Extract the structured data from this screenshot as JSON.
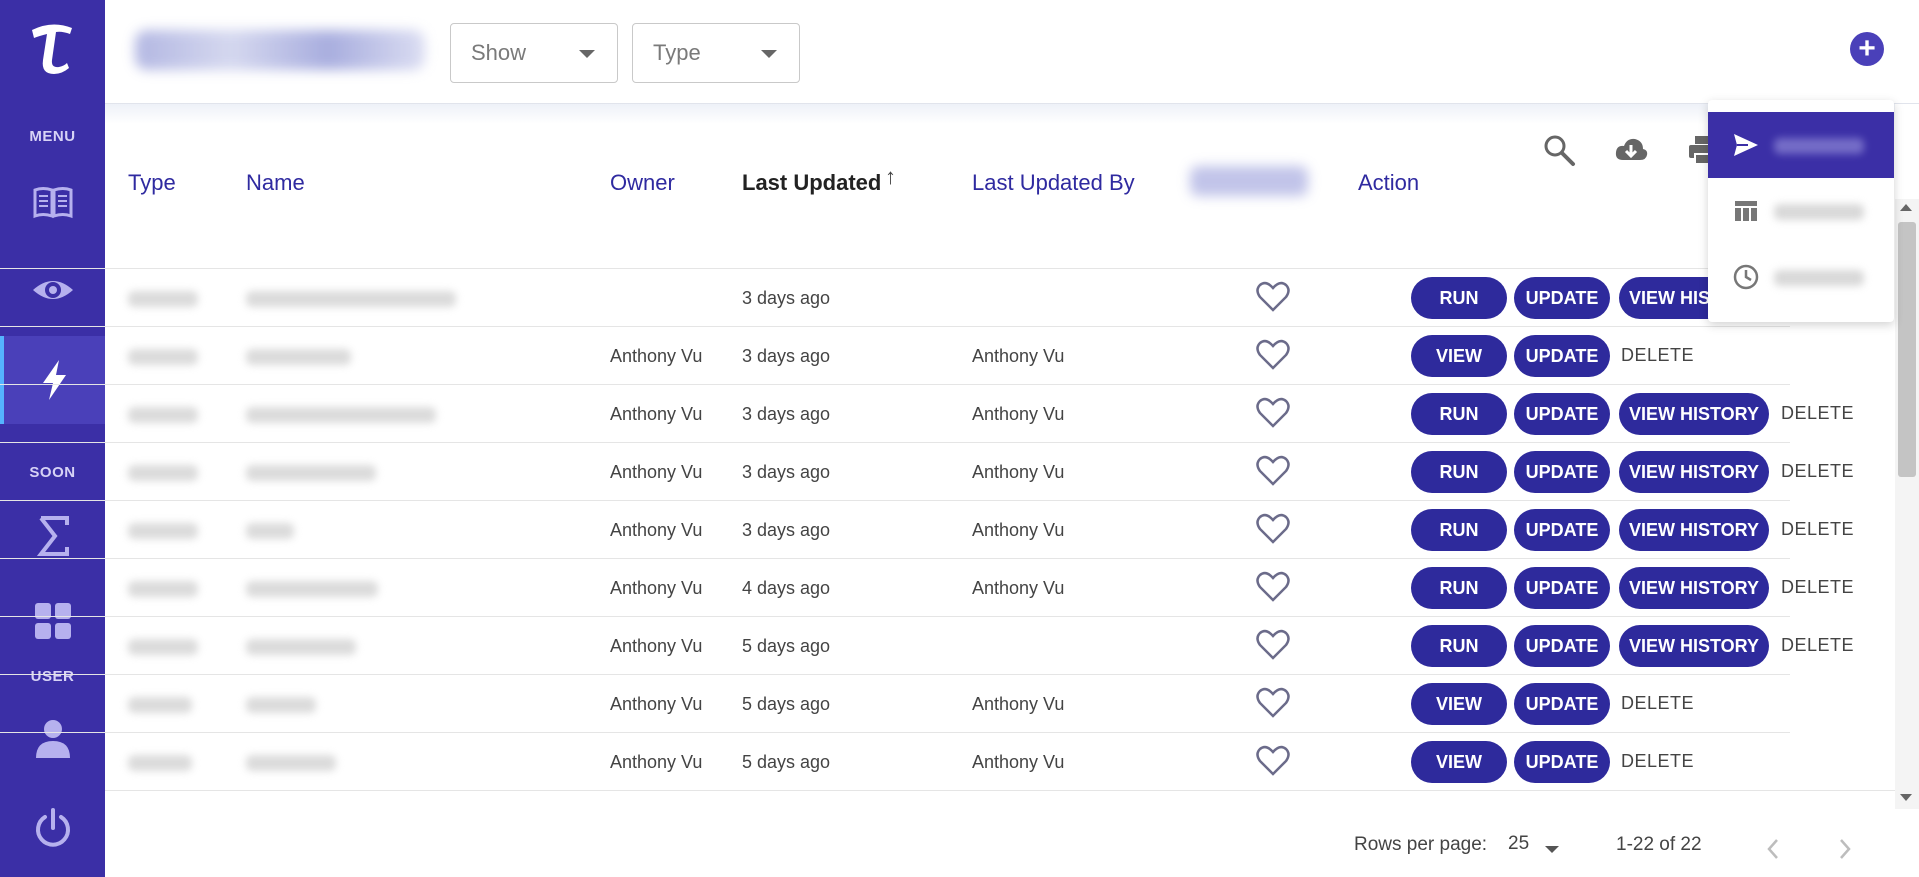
{
  "colors": {
    "sidebar": "#3b2fa6",
    "accent": "#2e2a9c",
    "header_link": "#2f2aa0",
    "active_indicator": "#55b3ff"
  },
  "sidebar": {
    "menu_label": "MENU",
    "soon_label": "SOON",
    "user_label": "USER",
    "items": [
      {
        "icon": "book-icon"
      },
      {
        "icon": "eye-icon"
      },
      {
        "icon": "lightning-icon",
        "active": true
      },
      {
        "icon": "sigma-icon"
      },
      {
        "icon": "dashboard-icon"
      },
      {
        "icon": "user-icon"
      },
      {
        "icon": "power-icon"
      }
    ]
  },
  "topbar": {
    "show_select": {
      "label": "Show"
    },
    "type_select": {
      "label": "Type"
    },
    "add_icon": "plus-circle-icon"
  },
  "toolbar": {
    "icons": [
      "search-icon",
      "cloud-download-icon",
      "print-icon"
    ]
  },
  "table": {
    "headers": {
      "type": "Type",
      "name": "Name",
      "owner": "Owner",
      "last_updated": "Last Updated",
      "sort_arrow": "↑",
      "last_updated_by": "Last Updated By",
      "action": "Action"
    },
    "buttons": {
      "run": "RUN",
      "view": "VIEW",
      "update": "UPDATE",
      "view_history": "VIEW HISTORY",
      "delete": "DELETE"
    },
    "rows": [
      {
        "owner": "",
        "last_updated": "3 days ago",
        "last_updated_by": "",
        "primary": "run"
      },
      {
        "owner": "Anthony Vu",
        "last_updated": "3 days ago",
        "last_updated_by": "Anthony Vu",
        "primary": "view"
      },
      {
        "owner": "Anthony Vu",
        "last_updated": "3 days ago",
        "last_updated_by": "Anthony Vu",
        "primary": "run"
      },
      {
        "owner": "Anthony Vu",
        "last_updated": "3 days ago",
        "last_updated_by": "Anthony Vu",
        "primary": "run"
      },
      {
        "owner": "Anthony Vu",
        "last_updated": "3 days ago",
        "last_updated_by": "Anthony Vu",
        "primary": "run"
      },
      {
        "owner": "Anthony Vu",
        "last_updated": "4 days ago",
        "last_updated_by": "Anthony Vu",
        "primary": "run"
      },
      {
        "owner": "Anthony Vu",
        "last_updated": "5 days ago",
        "last_updated_by": "",
        "primary": "run"
      },
      {
        "owner": "Anthony Vu",
        "last_updated": "5 days ago",
        "last_updated_by": "Anthony Vu",
        "primary": "view"
      },
      {
        "owner": "Anthony Vu",
        "last_updated": "5 days ago",
        "last_updated_by": "Anthony Vu",
        "primary": "view"
      }
    ]
  },
  "pagination": {
    "rows_per_page_label": "Rows per page:",
    "rows_per_page_value": "25",
    "range": "1-22 of 22",
    "prev_icon": "chevron-left-icon",
    "next_icon": "chevron-right-icon"
  },
  "menu": {
    "items": [
      {
        "icon": "send-icon",
        "active": true
      },
      {
        "icon": "table-icon"
      },
      {
        "icon": "clock-icon"
      }
    ]
  }
}
